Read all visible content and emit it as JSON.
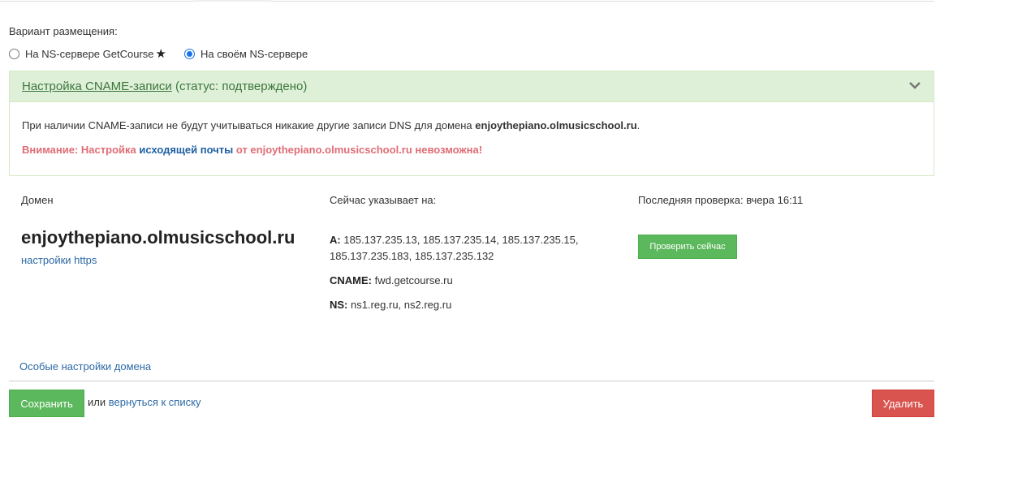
{
  "placement": {
    "label": "Вариант размещения:",
    "option_getcourse": "На NS-сервере GetCourse",
    "option_own": "На своём NS-сервере",
    "selected": "own"
  },
  "cname": {
    "title_link": "Настройка CNAME-записи",
    "status": "(статус: подтверждено)",
    "info_prefix": "При наличии CNAME-записи не будут учитываться никакие другие записи DNS для домена ",
    "info_domain": "enjoythepiano.olmusicschool.ru",
    "info_suffix": ".",
    "warn_prefix": "Внимание: Настройка ",
    "warn_link": "исходящей почты",
    "warn_suffix": " от enjoythepiano.olmusicschool.ru невозможна!"
  },
  "domain": {
    "column_label": "Домен",
    "name": "enjoythepiano.olmusicschool.ru",
    "https_link": "настройки https"
  },
  "dns": {
    "column_label": "Сейчас указывает на:",
    "a_label": "A:",
    "a_value": "185.137.235.13, 185.137.235.14, 185.137.235.15, 185.137.235.183, 185.137.235.132",
    "cname_label": "CNAME:",
    "cname_value": "fwd.getcourse.ru",
    "ns_label": "NS:",
    "ns_value": "ns1.reg.ru, ns2.reg.ru"
  },
  "check": {
    "last_check": "Последняя проверка: вчера 16:11",
    "button": "Проверить сейчас"
  },
  "footer": {
    "special_link": "Особые настройки домена",
    "save_button": "Сохранить",
    "or_text": "или ",
    "back_link": "вернуться к списку",
    "delete_button": "Удалить"
  },
  "colors": {
    "success": "#5cb85c",
    "danger": "#d9534f",
    "link": "#2d6aa6",
    "panel_head_bg": "#dff0d8",
    "warning_text": "#e06c75"
  }
}
